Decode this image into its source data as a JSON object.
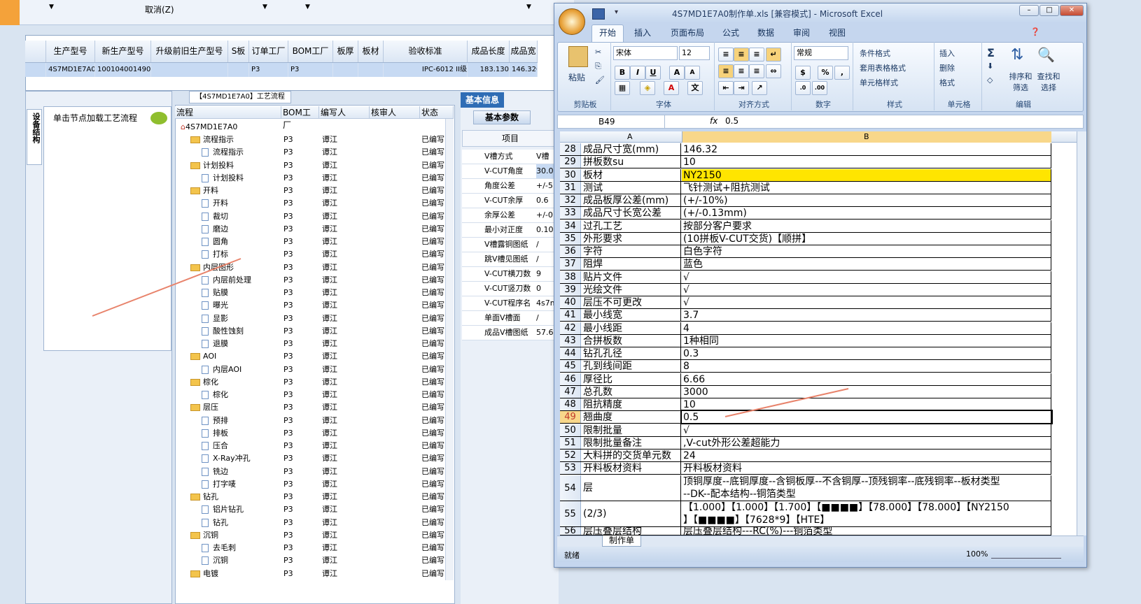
{
  "topbar": {
    "cancel": "取消(Z)"
  },
  "grid": {
    "headers": [
      "",
      "生产型号",
      "新生产型号",
      "升级前旧生产型号",
      "S板",
      "订单工厂",
      "BOM工厂",
      "板厚",
      "板材",
      "验收标准",
      "成品长度",
      "成品宽"
    ],
    "row": [
      "",
      "4S7MD1E7A0",
      "10010400149032",
      "",
      "",
      "P3",
      "P3",
      "",
      "",
      "IPC-6012 II级",
      "183.130",
      "146.320"
    ]
  },
  "left": {
    "side_tab": "设备结构",
    "click_text": "单击节点加载工艺流程"
  },
  "tree": {
    "title": "【4S7MD1E7A0】工艺流程",
    "headers": [
      "流程",
      "BOM工厂",
      "编写人",
      "核审人",
      "状态"
    ],
    "root": "4S7MD1E7A0",
    "rows": [
      {
        "name": "流程指示",
        "level": 1,
        "folder": true
      },
      {
        "name": "流程指示",
        "level": 2,
        "folder": false
      },
      {
        "name": "计划投料",
        "level": 1,
        "folder": true
      },
      {
        "name": "计划投料",
        "level": 2,
        "folder": false
      },
      {
        "name": "开料",
        "level": 1,
        "folder": true
      },
      {
        "name": "开料",
        "level": 2,
        "folder": false
      },
      {
        "name": "裁切",
        "level": 2,
        "folder": false
      },
      {
        "name": "磨边",
        "level": 2,
        "folder": false
      },
      {
        "name": "圆角",
        "level": 2,
        "folder": false
      },
      {
        "name": "打标",
        "level": 2,
        "folder": false
      },
      {
        "name": "内层图形",
        "level": 1,
        "folder": true
      },
      {
        "name": "内层前处理",
        "level": 2,
        "folder": false
      },
      {
        "name": "贴膜",
        "level": 2,
        "folder": false
      },
      {
        "name": "曝光",
        "level": 2,
        "folder": false
      },
      {
        "name": "显影",
        "level": 2,
        "folder": false
      },
      {
        "name": "酸性蚀刻",
        "level": 2,
        "folder": false
      },
      {
        "name": "退膜",
        "level": 2,
        "folder": false
      },
      {
        "name": "AOI",
        "level": 1,
        "folder": true
      },
      {
        "name": "内层AOI",
        "level": 2,
        "folder": false
      },
      {
        "name": "棕化",
        "level": 1,
        "folder": true
      },
      {
        "name": "棕化",
        "level": 2,
        "folder": false
      },
      {
        "name": "层压",
        "level": 1,
        "folder": true
      },
      {
        "name": "预排",
        "level": 2,
        "folder": false
      },
      {
        "name": "排板",
        "level": 2,
        "folder": false
      },
      {
        "name": "压合",
        "level": 2,
        "folder": false
      },
      {
        "name": "X-Ray冲孔",
        "level": 2,
        "folder": false
      },
      {
        "name": "铣边",
        "level": 2,
        "folder": false
      },
      {
        "name": "打字唛",
        "level": 2,
        "folder": false
      },
      {
        "name": "钻孔",
        "level": 1,
        "folder": true
      },
      {
        "name": "铝片钻孔",
        "level": 2,
        "folder": false
      },
      {
        "name": "钻孔",
        "level": 2,
        "folder": false
      },
      {
        "name": "沉铜",
        "level": 1,
        "folder": true
      },
      {
        "name": "去毛刺",
        "level": 2,
        "folder": false
      },
      {
        "name": "沉铜",
        "level": 2,
        "folder": false
      },
      {
        "name": "电镀",
        "level": 1,
        "folder": true
      }
    ],
    "bom": "P3",
    "writer": "谭江",
    "status": "已编写"
  },
  "basic": {
    "tab": "基本信息",
    "subtab": "基本参数",
    "col_item": "项目",
    "rows": [
      [
        "V槽方式",
        "V槽"
      ],
      [
        "V-CUT角度",
        "30.0"
      ],
      [
        "角度公差",
        "+/-5"
      ],
      [
        "V-CUT余厚",
        "0.6"
      ],
      [
        "余厚公差",
        "+/-0"
      ],
      [
        "最小对正度",
        "0.10"
      ],
      [
        "V槽露铜图纸",
        "/"
      ],
      [
        "跳V槽见图纸",
        "/"
      ],
      [
        "V-CUT横刀数",
        "9"
      ],
      [
        "V-CUT竖刀数",
        "0"
      ],
      [
        "V-CUT程序名",
        "4s7m"
      ],
      [
        "单面V槽面",
        "/"
      ],
      [
        "成品V槽图纸",
        "57.6"
      ]
    ]
  },
  "excel": {
    "title": "4S7MD1E7A0制作单.xls [兼容模式] - Microsoft Excel",
    "tabs": [
      "开始",
      "插入",
      "页面布局",
      "公式",
      "数据",
      "审阅",
      "视图"
    ],
    "font": "宋体",
    "size": "12",
    "numfmt": "常规",
    "groups": [
      "剪贴板",
      "字体",
      "对齐方式",
      "数字",
      "样式",
      "单元格",
      "编辑"
    ],
    "buttons": {
      "paste": "粘贴",
      "cond": "条件格式",
      "table": "套用表格格式",
      "cellstyle": "单元格样式",
      "insert": "插入",
      "delete": "删除",
      "format": "格式",
      "sort": "排序和筛选",
      "find": "查找和选择"
    },
    "namebox": "B49",
    "formula": "0.5",
    "col_a": "A",
    "col_b": "B",
    "rows": [
      [
        "28",
        "成品尺寸宽(mm)",
        "146.32"
      ],
      [
        "29",
        "拼板数su",
        "10"
      ],
      [
        "30",
        "板材",
        "NY2150"
      ],
      [
        "31",
        "测试",
        "飞针测试+阻抗测试"
      ],
      [
        "32",
        "成品板厚公差(mm)",
        "(+/-10%)"
      ],
      [
        "33",
        "成品尺寸长宽公差",
        "(+/-0.13mm)"
      ],
      [
        "34",
        "过孔工艺",
        "按部分客户要求"
      ],
      [
        "35",
        "外形要求",
        "(10拼板V-CUT交货)【顺拼】"
      ],
      [
        "36",
        "字符",
        "白色字符"
      ],
      [
        "37",
        "阻焊",
        "蓝色"
      ],
      [
        "38",
        "贴片文件",
        "√"
      ],
      [
        "39",
        "光绘文件",
        "√"
      ],
      [
        "40",
        "层压不可更改",
        "√"
      ],
      [
        "41",
        "最小线宽",
        "3.7"
      ],
      [
        "42",
        "最小线距",
        "4"
      ],
      [
        "43",
        "合拼板数",
        "1种相同"
      ],
      [
        "44",
        "钻孔孔径",
        "0.3"
      ],
      [
        "45",
        "孔到线间距",
        "8"
      ],
      [
        "46",
        "厚径比",
        "6.66"
      ],
      [
        "47",
        "总孔数",
        "3000"
      ],
      [
        "48",
        "阻抗精度",
        "10"
      ],
      [
        "49",
        "翘曲度",
        "0.5"
      ],
      [
        "50",
        "限制批量",
        "√"
      ],
      [
        "51",
        "限制批量备注",
        ",V-cut外形公差超能力"
      ],
      [
        "52",
        "大料拼的交货单元数",
        "24"
      ],
      [
        "53",
        "开料板材资料",
        "开料板材资料"
      ]
    ],
    "row54": {
      "num": "54",
      "a": "层",
      "b1": "顶铜厚度--底铜厚度--含铜板厚--不含铜厚--顶残铜率--底残铜率--板材类型",
      "b2": "--DK--配本结构--铜箔类型"
    },
    "row55": {
      "num": "55",
      "a": "(2/3)",
      "b1": "【1.000】【1.000】【1.700】【■■■■】【78.000】【78.000】【NY2150",
      "b2": "】【■■■■】【7628*9】【HTE】"
    },
    "row56": {
      "num": "56",
      "a": "层压叠层结构",
      "b": "层压叠层结构---RC(%)---铜箔类型"
    },
    "sheet_tab": "制作单",
    "status": "就绪",
    "zoom": "100%"
  }
}
